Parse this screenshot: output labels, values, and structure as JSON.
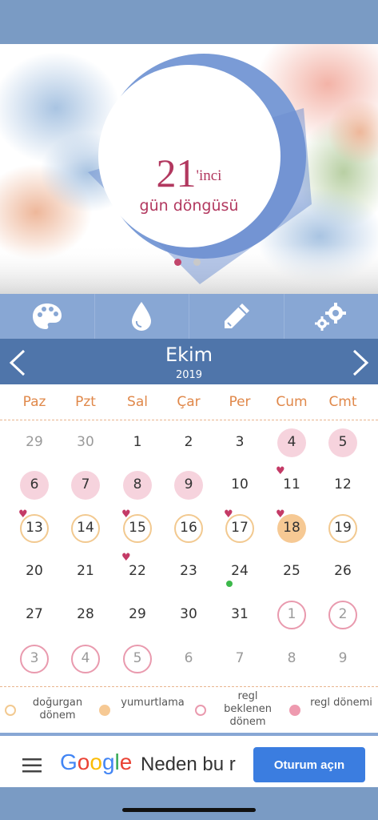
{
  "header": {
    "cycle_day": "21",
    "cycle_suffix": "'inci",
    "cycle_label": "gün döngüsü",
    "page_dots": [
      "active",
      "inactive"
    ]
  },
  "toolbar": {
    "items": [
      {
        "icon": "palette-icon"
      },
      {
        "icon": "drop-icon"
      },
      {
        "icon": "pencil-icon"
      },
      {
        "icon": "gears-icon"
      }
    ]
  },
  "calendar": {
    "month": "Ekim",
    "year": "2019",
    "prev_icon": "chevron-left-icon",
    "next_icon": "chevron-right-icon",
    "weekdays": [
      "Paz",
      "Pzt",
      "Sal",
      "Çar",
      "Per",
      "Cum",
      "Cmt"
    ],
    "weeks": [
      [
        {
          "d": "29",
          "t": "muted"
        },
        {
          "d": "30",
          "t": "muted"
        },
        {
          "d": "1"
        },
        {
          "d": "2"
        },
        {
          "d": "3"
        },
        {
          "d": "4",
          "t": "period"
        },
        {
          "d": "5",
          "t": "period"
        }
      ],
      [
        {
          "d": "6",
          "t": "period"
        },
        {
          "d": "7",
          "t": "period"
        },
        {
          "d": "8",
          "t": "period"
        },
        {
          "d": "9",
          "t": "period"
        },
        {
          "d": "10"
        },
        {
          "d": "11",
          "h": true
        },
        {
          "d": "12"
        }
      ],
      [
        {
          "d": "13",
          "t": "fertile",
          "h": true
        },
        {
          "d": "14",
          "t": "fertile"
        },
        {
          "d": "15",
          "t": "fertile",
          "h": true
        },
        {
          "d": "16",
          "t": "fertile"
        },
        {
          "d": "17",
          "t": "fertile",
          "h": true
        },
        {
          "d": "18",
          "t": "ovulation",
          "h": true
        },
        {
          "d": "19",
          "t": "fertile"
        }
      ],
      [
        {
          "d": "20"
        },
        {
          "d": "21"
        },
        {
          "d": "22",
          "h": true
        },
        {
          "d": "23"
        },
        {
          "d": "24",
          "g": true
        },
        {
          "d": "25"
        },
        {
          "d": "26"
        }
      ],
      [
        {
          "d": "27"
        },
        {
          "d": "28"
        },
        {
          "d": "29"
        },
        {
          "d": "30"
        },
        {
          "d": "31"
        },
        {
          "d": "1",
          "t": "expected"
        },
        {
          "d": "2",
          "t": "expected"
        }
      ],
      [
        {
          "d": "3",
          "t": "expected"
        },
        {
          "d": "4",
          "t": "expected"
        },
        {
          "d": "5",
          "t": "expected"
        },
        {
          "d": "6",
          "t": "muted"
        },
        {
          "d": "7",
          "t": "muted"
        },
        {
          "d": "8",
          "t": "muted"
        },
        {
          "d": "9",
          "t": "muted"
        }
      ]
    ]
  },
  "legend": {
    "fertile": "doğurgan dönem",
    "ovulation": "yumurtlama",
    "expected": "regl beklenen dönem",
    "period": "regl dönemi"
  },
  "ad": {
    "menu_icon": "hamburger-menu-icon",
    "brand": "Google",
    "text": "Neden bu r",
    "button": "Oturum açın"
  },
  "colors": {
    "accent": "#4f75aa",
    "toolbar": "#88a7d4",
    "cycle_text": "#b2385f",
    "weekday": "#e0884a",
    "period_fill": "#f6d3dd",
    "fertile_ring": "#f2c990",
    "ovulation_fill": "#f6c994",
    "expected_ring": "#e99aae",
    "heart": "#c43a66"
  }
}
